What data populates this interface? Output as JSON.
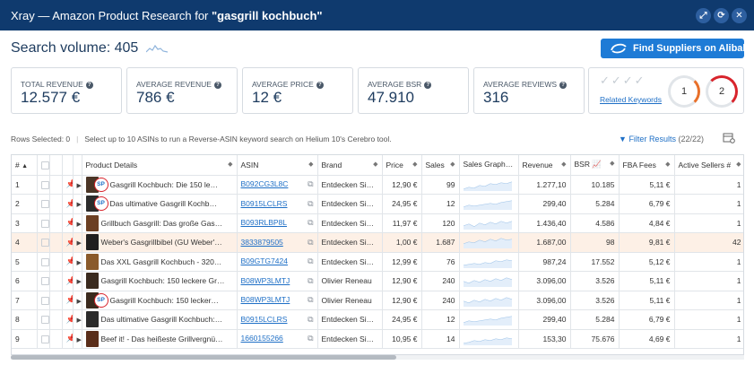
{
  "window": {
    "title_prefix": "Xray — Amazon Product Research for ",
    "title_query": "\"gasgrill kochbuch\""
  },
  "search_volume": {
    "label": "Search volume: 405"
  },
  "alibaba": {
    "label": "Find Suppliers on Alibaba"
  },
  "stats": [
    {
      "label": "TOTAL REVENUE",
      "value": "12.577 €"
    },
    {
      "label": "AVERAGE REVENUE",
      "value": "786 €"
    },
    {
      "label": "AVERAGE PRICE",
      "value": "12 €"
    },
    {
      "label": "AVERAGE BSR",
      "value": "47.910"
    },
    {
      "label": "AVERAGE REVIEWS",
      "value": "316"
    }
  ],
  "related": {
    "label": "Related Keywords",
    "checks": "✓✓✓✓",
    "ring1": "1",
    "ring2": "2"
  },
  "toolbar": {
    "rows_selected": "Rows Selected: 0",
    "hint": "Select up to 10 ASINs to run a Reverse-ASIN keyword search on Helium 10's Cerebro tool.",
    "filter_label": "Filter Results",
    "filter_count": "(22/22)"
  },
  "columns": {
    "num": "#",
    "product": "Product Details",
    "asin": "ASIN",
    "brand": "Brand",
    "price": "Price",
    "sales": "Sales",
    "graph": "Sales Graph",
    "revenue": "Revenue",
    "bsr": "BSR",
    "fba": "FBA Fees",
    "sellers": "Active Sellers #"
  },
  "rows": [
    {
      "n": "1",
      "title": "Gasgrill Kochbuch: Die 150 le…",
      "sp": "SP",
      "asin": "B092CG3L8C",
      "brand": "Entdecken Sie…",
      "price": "12,90 €",
      "sales": "99",
      "revenue": "1.277,10",
      "bsr": "10.185",
      "fba": "5,11 €",
      "sellers": "1",
      "thumb": "#4a3526"
    },
    {
      "n": "2",
      "title": "Das ultimative Gasgrill Kochb…",
      "sp": "SP",
      "asin": "B0915LCLRS",
      "brand": "Entdecken Sie…",
      "price": "24,95 €",
      "sales": "12",
      "revenue": "299,40",
      "bsr": "5.284",
      "fba": "6,79 €",
      "sellers": "1",
      "thumb": "#2b2b2b"
    },
    {
      "n": "3",
      "title": "Grillbuch Gasgrill: Das große Gas…",
      "sp": "",
      "asin": "B093RLBP8L",
      "brand": "Entdecken Sie…",
      "price": "11,97 €",
      "sales": "120",
      "revenue": "1.436,40",
      "bsr": "4.586",
      "fba": "4,84 €",
      "sellers": "1",
      "thumb": "#6b3f23"
    },
    {
      "n": "4",
      "title": "Weber's Gasgrillbibel (GU Weber'…",
      "sp": "",
      "asin": "3833879505",
      "brand": "Entdecken Sie…",
      "price": "1,00 €",
      "sales": "1.687",
      "revenue": "1.687,00",
      "bsr": "98",
      "fba": "9,81 €",
      "sellers": "42",
      "thumb": "#1f1f1f"
    },
    {
      "n": "5",
      "title": "Das XXL Gasgrill Kochbuch - 320…",
      "sp": "",
      "asin": "B09GTG7424",
      "brand": "Entdecken Sie…",
      "price": "12,99 €",
      "sales": "76",
      "revenue": "987,24",
      "bsr": "17.552",
      "fba": "5,12 €",
      "sellers": "1",
      "thumb": "#8a5a2b"
    },
    {
      "n": "6",
      "title": "Gasgrill Kochbuch: 150 leckere Gr…",
      "sp": "",
      "asin": "B08WP3LMTJ",
      "brand": "Olivier Reneau",
      "price": "12,90 €",
      "sales": "240",
      "revenue": "3.096,00",
      "bsr": "3.526",
      "fba": "5,11 €",
      "sellers": "1",
      "thumb": "#3a2a1e"
    },
    {
      "n": "7",
      "title": "Gasgrill Kochbuch: 150 lecker…",
      "sp": "SP",
      "asin": "B08WP3LMTJ",
      "brand": "Olivier Reneau",
      "price": "12,90 €",
      "sales": "240",
      "revenue": "3.096,00",
      "bsr": "3.526",
      "fba": "5,11 €",
      "sellers": "1",
      "thumb": "#3a2a1e"
    },
    {
      "n": "8",
      "title": "Das ultimative Gasgrill Kochbuch:…",
      "sp": "",
      "asin": "B0915LCLRS",
      "brand": "Entdecken Sie…",
      "price": "24,95 €",
      "sales": "12",
      "revenue": "299,40",
      "bsr": "5.284",
      "fba": "6,79 €",
      "sellers": "1",
      "thumb": "#2b2b2b"
    },
    {
      "n": "9",
      "title": "Beef it! - Das heißeste Grillvergnü…",
      "sp": "",
      "asin": "1660155266",
      "brand": "Entdecken Sie…",
      "price": "10,95 €",
      "sales": "14",
      "revenue": "153,30",
      "bsr": "75.676",
      "fba": "4,69 €",
      "sellers": "1",
      "thumb": "#5a2e1a"
    }
  ],
  "colors": {
    "title_bar": "#0f3a6e",
    "accent": "#1e7bd6",
    "link": "#1e6fc6",
    "highlight_row": "#fdf0e6",
    "sp_ring": "#d8242c"
  }
}
